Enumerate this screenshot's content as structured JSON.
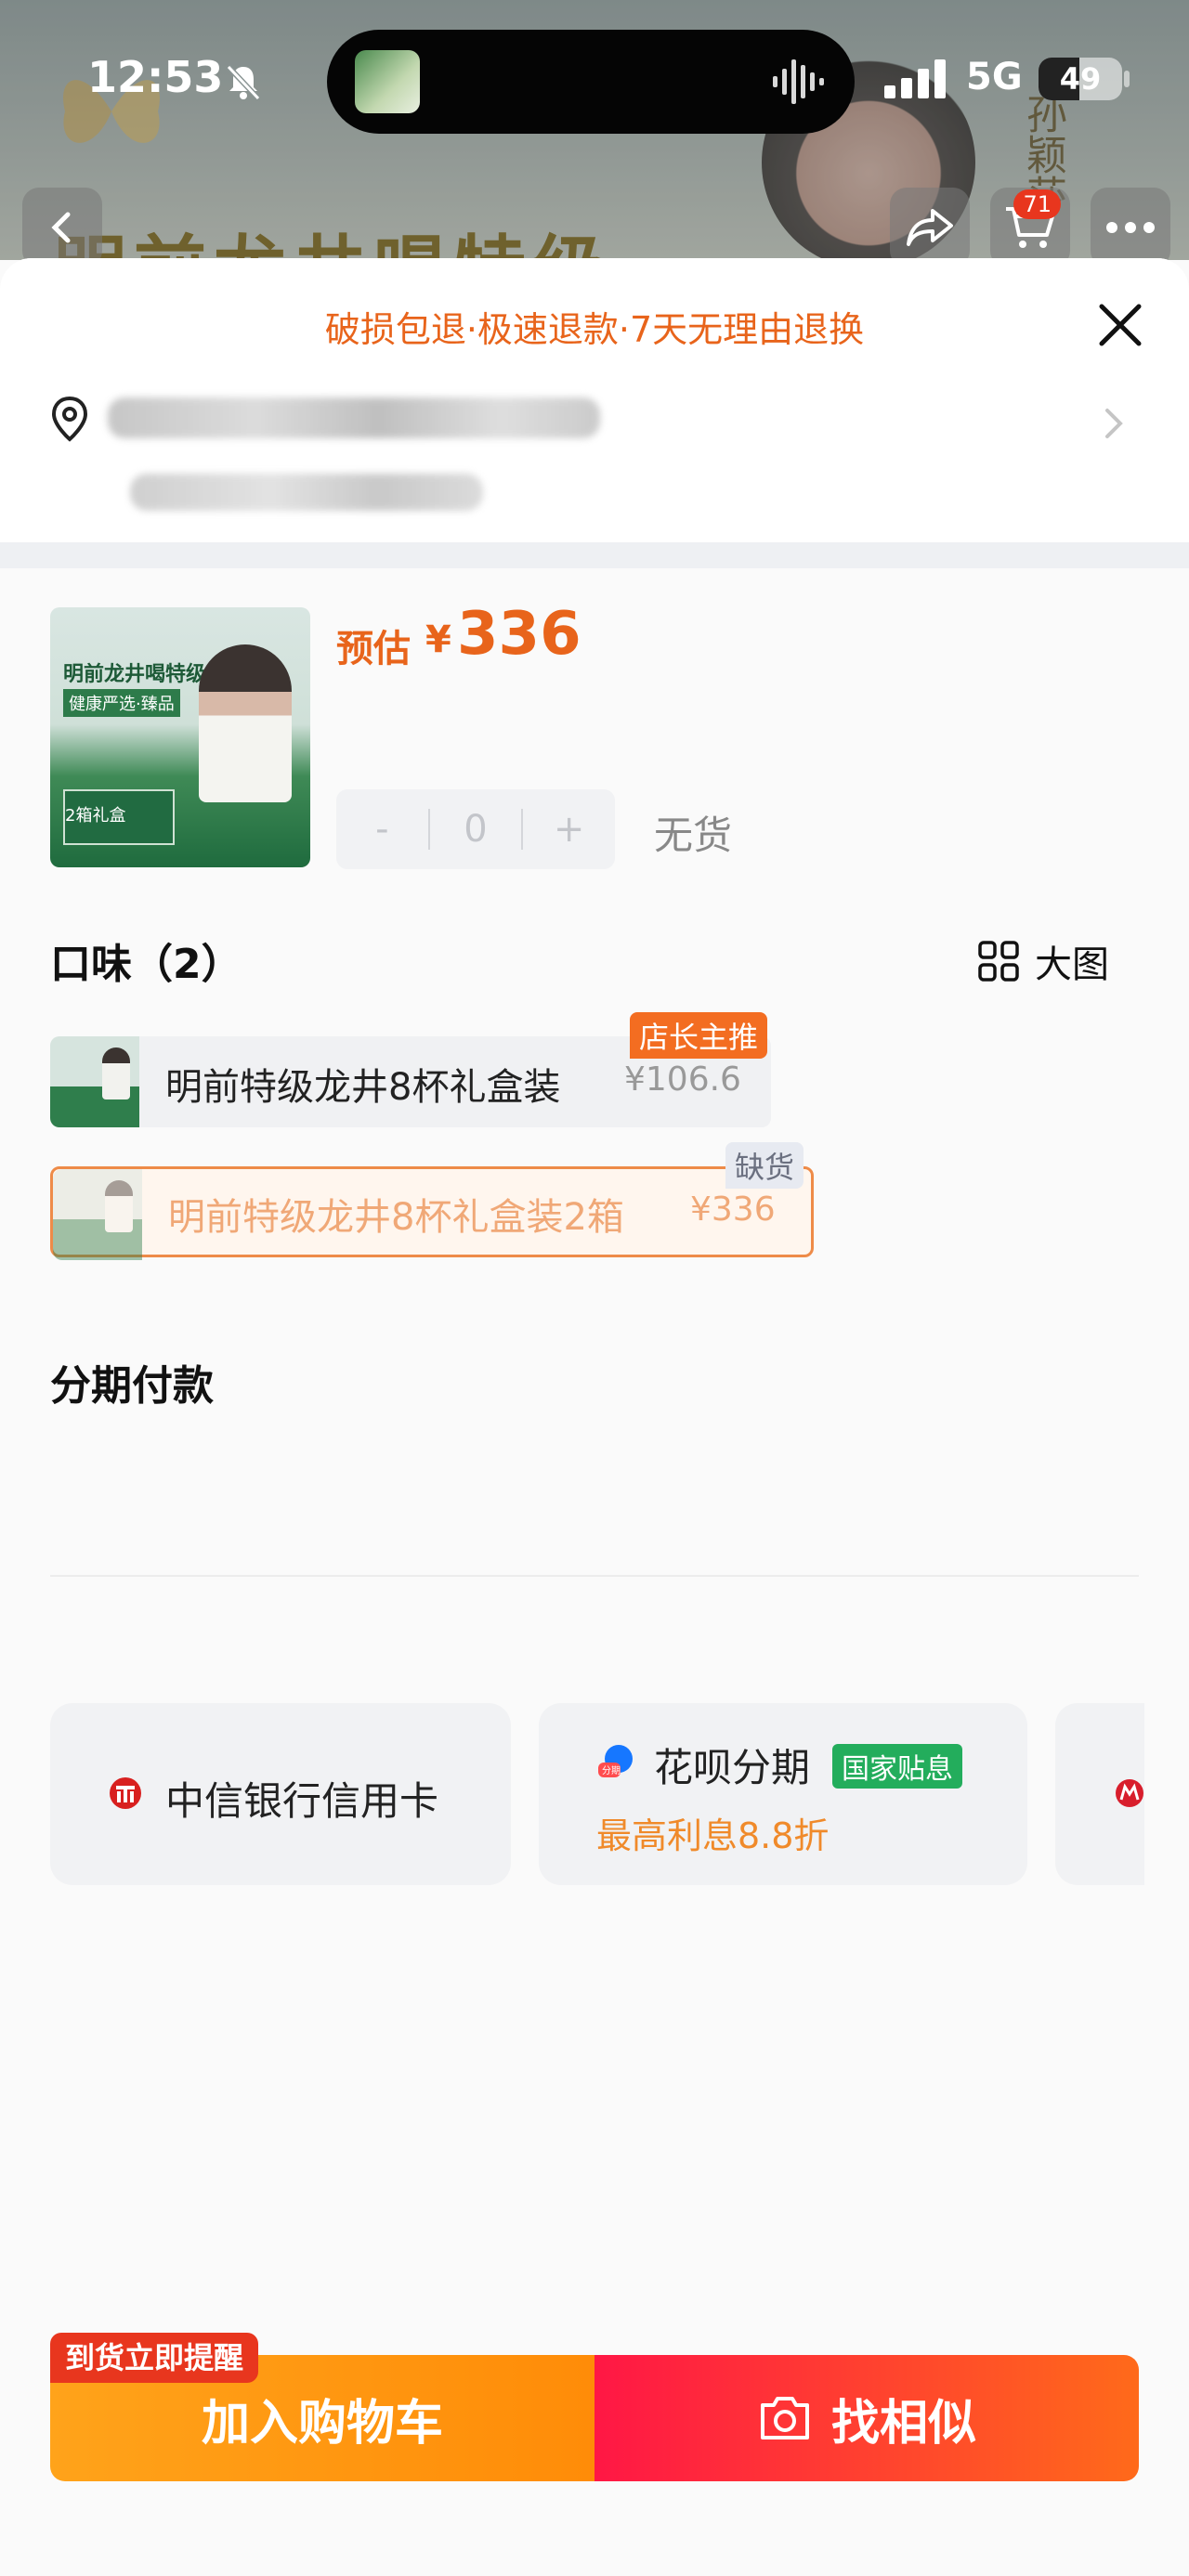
{
  "status_bar": {
    "time": "12:53",
    "network": "5G",
    "battery": "49",
    "battery_level": 0.49
  },
  "background_page": {
    "title_fragment": "明前龙井喝特级",
    "side_text": "孙颖莎",
    "cart_count": "71"
  },
  "sheet": {
    "guarantee": "破损包退·极速退款·7天无理由退换",
    "product": {
      "image_title": "明前龙井喝特级",
      "image_subtitle": "健康严选·臻品",
      "image_box_label": "2箱礼盒",
      "price_prefix": "预估",
      "currency": "¥",
      "price": "336",
      "quantity": "0",
      "minus": "-",
      "plus": "+",
      "stock_status": "无货"
    },
    "flavor": {
      "title": "口味（2）",
      "big_image_label": "大图",
      "variants": [
        {
          "name": "明前特级龙井8杯礼盒装",
          "price": "¥106.6",
          "tag": "店长主推"
        },
        {
          "name": "明前特级龙井8杯礼盒装2箱",
          "price": "¥336",
          "tag": "缺货"
        }
      ]
    },
    "installment": {
      "title": "分期付款",
      "cards": [
        {
          "label": "中信银行信用卡"
        },
        {
          "label": "花呗分期",
          "badge": "国家贴息",
          "sub": "最高利息8.8折"
        }
      ]
    },
    "bottom": {
      "notify_tag": "到货立即提醒",
      "add_to_cart": "加入购物车",
      "find_similar": "找相似"
    }
  },
  "colors": {
    "accent_orange": "#e8641b",
    "cart_button": "#ff9a10",
    "similar_button": "#ff1745",
    "gov_badge": "#23ad5c"
  }
}
